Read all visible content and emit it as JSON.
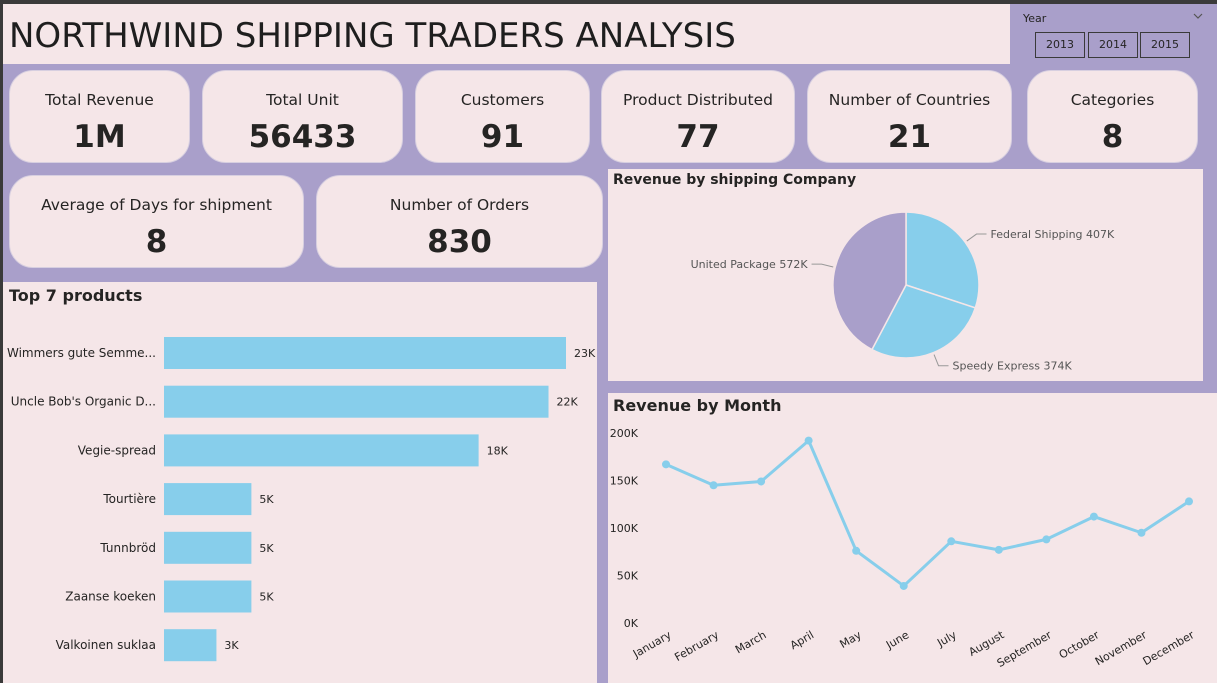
{
  "header": {
    "title": "NORTHWIND SHIPPING TRADERS ANALYSIS"
  },
  "slicer": {
    "label": "Year",
    "options": [
      "2013",
      "2014",
      "2015"
    ]
  },
  "kpis": [
    {
      "label": "Total Revenue",
      "value": "1M"
    },
    {
      "label": "Total Unit",
      "value": "56433"
    },
    {
      "label": "Customers",
      "value": "91"
    },
    {
      "label": "Product Distributed",
      "value": "77"
    },
    {
      "label": "Number of Countries",
      "value": "21"
    },
    {
      "label": "Categories",
      "value": "8"
    },
    {
      "label": "Average of Days for shipment",
      "value": "8"
    },
    {
      "label": "Number of Orders",
      "value": "830"
    }
  ],
  "colors": {
    "background": "#a99fca",
    "panel": "#f5e6e8",
    "bar": "#87ceeb",
    "line": "#87ceeb",
    "pie_purple": "#a99fca"
  },
  "chart_data": [
    {
      "type": "bar",
      "orientation": "horizontal",
      "title": "Top 7 products",
      "categories": [
        "Wimmers gute Semme...",
        "Uncle Bob's Organic D...",
        "Vegie-spread",
        "Tourtière",
        "Tunnbröd",
        "Zaanse koeken",
        "Valkoinen suklaa"
      ],
      "values": [
        23,
        22,
        18,
        5,
        5,
        5,
        3
      ],
      "value_labels": [
        "23K",
        "22K",
        "18K",
        "5K",
        "5K",
        "5K",
        "3K"
      ],
      "unit": "K",
      "xlim": [
        0,
        23
      ]
    },
    {
      "type": "pie",
      "title": "Revenue by shipping Company",
      "slices": [
        {
          "label": "Federal Shipping",
          "value": 407,
          "display": "Federal Shipping 407K",
          "color": "#87ceeb"
        },
        {
          "label": "Speedy Express",
          "value": 374,
          "display": "Speedy Express 374K",
          "color": "#87ceeb"
        },
        {
          "label": "United Package",
          "value": 572,
          "display": "United Package 572K",
          "color": "#a99fca"
        }
      ]
    },
    {
      "type": "line",
      "title": "Revenue by Month",
      "x": [
        "January",
        "February",
        "March",
        "April",
        "May",
        "June",
        "July",
        "August",
        "September",
        "October",
        "November",
        "December"
      ],
      "values": [
        167,
        145,
        149,
        192,
        76,
        39,
        86,
        77,
        88,
        112,
        95,
        128
      ],
      "unit": "K",
      "ylim": [
        0,
        200
      ],
      "yticks": [
        "0K",
        "50K",
        "100K",
        "150K",
        "200K"
      ],
      "ytick_values": [
        0,
        50,
        100,
        150,
        200
      ]
    }
  ]
}
